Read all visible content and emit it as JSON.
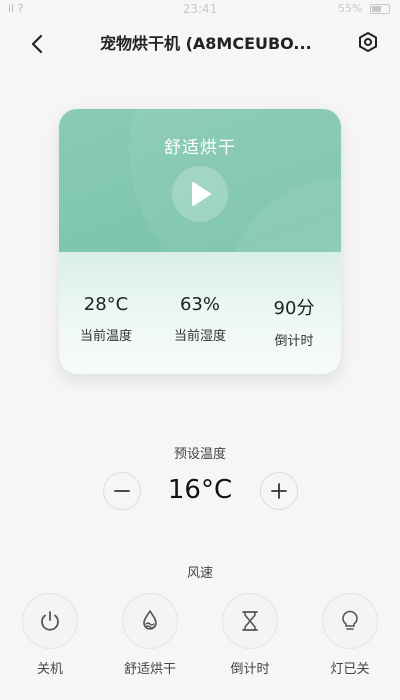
{
  "status_bar": {
    "left": "il ?",
    "time": "23:41",
    "right": "55%"
  },
  "header": {
    "title": "宠物烘干机 (A8MCEUBO..."
  },
  "card": {
    "mode": "舒适烘干",
    "stats": [
      {
        "value": "28°C",
        "label": "当前温度"
      },
      {
        "value": "63%",
        "label": "当前湿度"
      },
      {
        "value": "90分",
        "label": "倒计时"
      }
    ]
  },
  "preset": {
    "label": "预设温度",
    "value": "16°C"
  },
  "fan": {
    "label": "风速",
    "controls": [
      {
        "label": "关机",
        "icon": "power-icon"
      },
      {
        "label": "舒适烘干",
        "icon": "drop-wave-icon"
      },
      {
        "label": "倒计时",
        "icon": "hourglass-icon"
      },
      {
        "label": "灯已关",
        "icon": "bulb-icon"
      }
    ]
  },
  "colors": {
    "accent": "#7cc4ab",
    "background": "#f6f6f6"
  }
}
